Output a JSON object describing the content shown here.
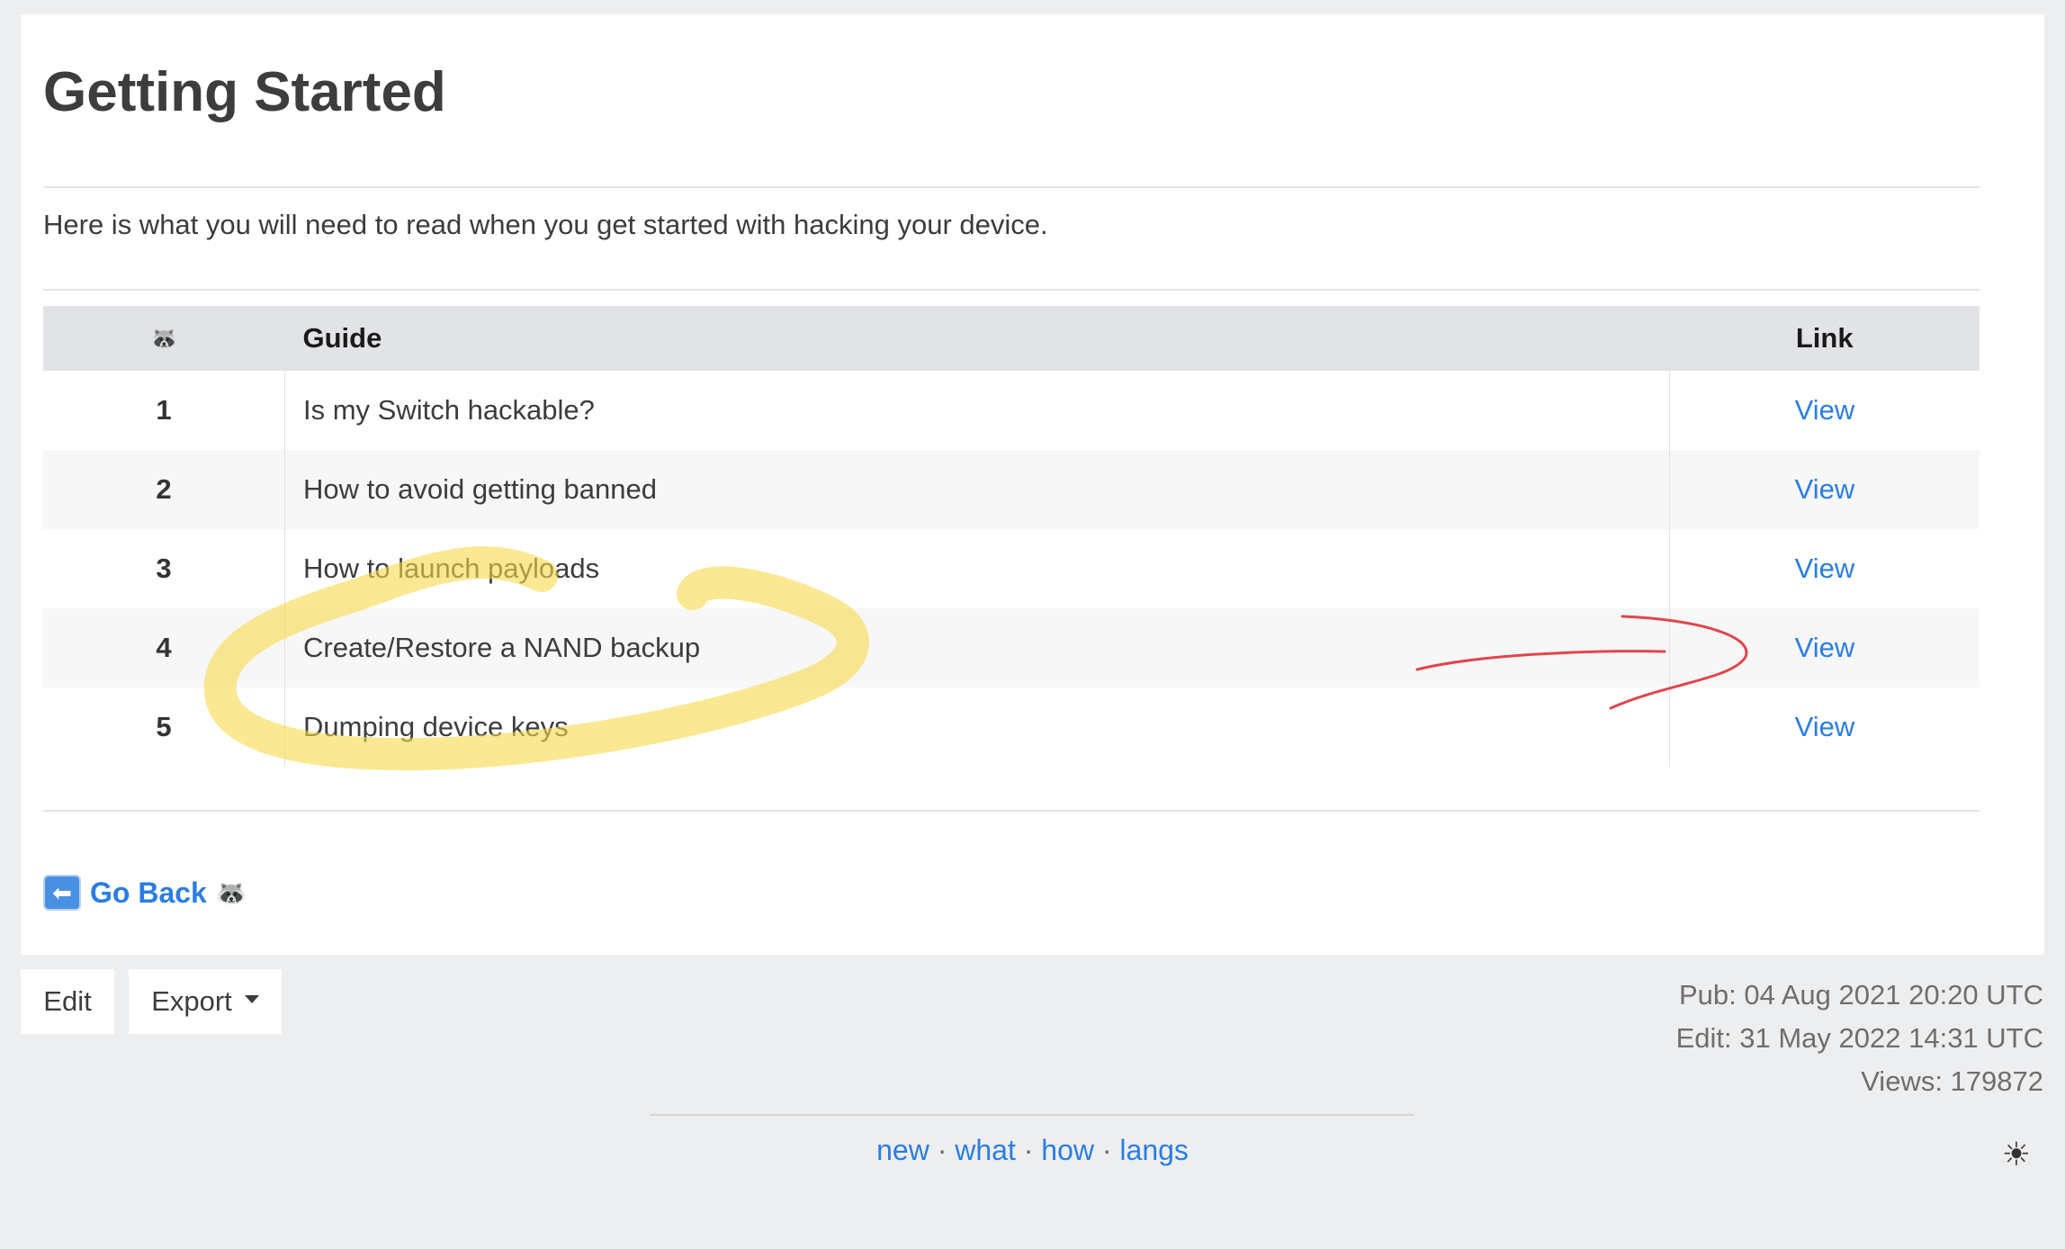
{
  "page": {
    "title": "Getting Started",
    "intro": "Here is what you will need to read when you get started with hacking your device."
  },
  "table": {
    "headers": {
      "icon": "🦝",
      "guide": "Guide",
      "link": "Link"
    },
    "rows": [
      {
        "num": "1",
        "guide": "Is my Switch hackable?",
        "link": "View"
      },
      {
        "num": "2",
        "guide": "How to avoid getting banned",
        "link": "View"
      },
      {
        "num": "3",
        "guide": "How to launch payloads",
        "link": "View"
      },
      {
        "num": "4",
        "guide": "Create/Restore a NAND backup",
        "link": "View"
      },
      {
        "num": "5",
        "guide": "Dumping device keys",
        "link": "View"
      }
    ]
  },
  "goback": {
    "icon": "⬅",
    "label": "Go Back",
    "trailing_icon": "🦝"
  },
  "toolbar": {
    "edit_label": "Edit",
    "export_label": "Export"
  },
  "meta": {
    "published": "Pub: 04 Aug 2021 20:20 UTC",
    "edited": "Edit: 31 May 2022 14:31 UTC",
    "views": "Views: 179872"
  },
  "footer": {
    "links": [
      "new",
      "what",
      "how",
      "langs"
    ],
    "separator": "·",
    "theme_icon": "☀"
  },
  "colors": {
    "link": "#2b7de1",
    "highlight": "#f7d84a",
    "arrow": "#e0464c",
    "header_bg": "#e1e3e6"
  }
}
